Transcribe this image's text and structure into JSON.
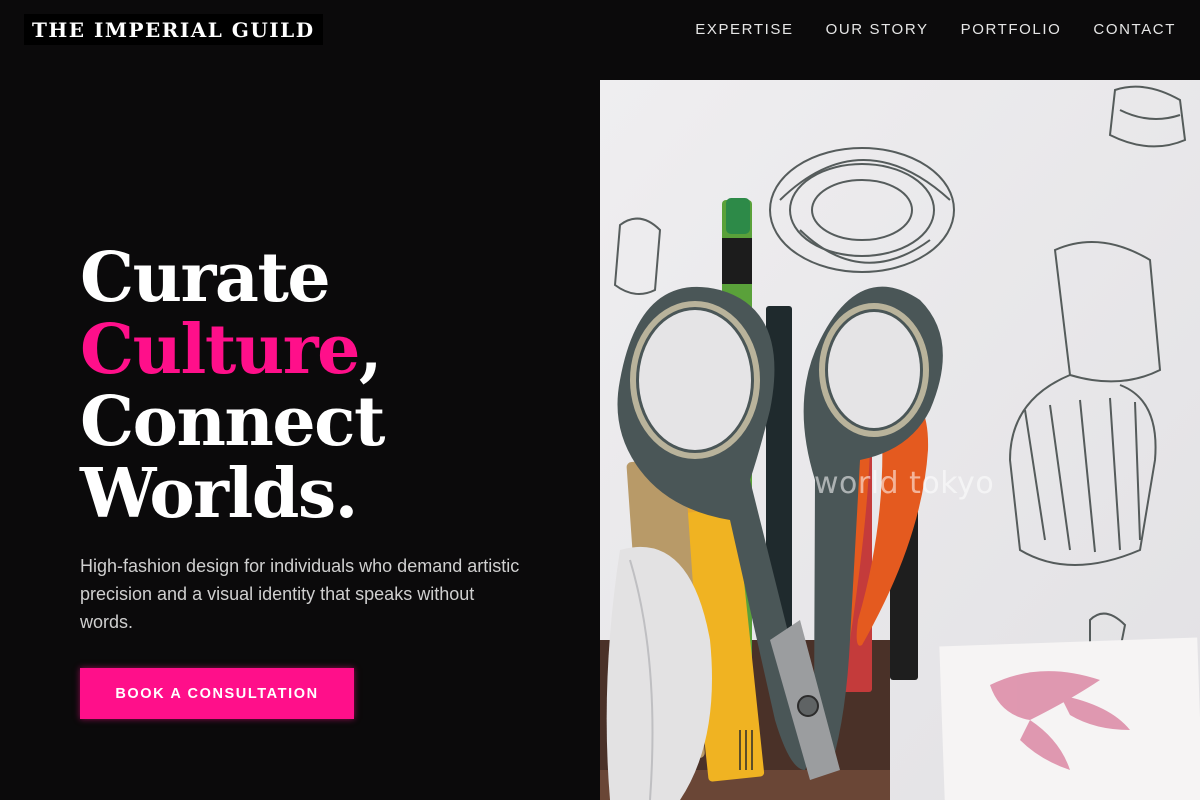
{
  "header": {
    "logo_text": "THE IMPERIAL GUILD",
    "nav": [
      {
        "label": "EXPERTISE"
      },
      {
        "label": "OUR STORY"
      },
      {
        "label": "PORTFOLIO"
      },
      {
        "label": "CONTACT"
      }
    ]
  },
  "hero": {
    "headline": {
      "line1": "Curate",
      "line2_accent": "Culture",
      "line2_rest": ",",
      "line3": "Connect",
      "line4": "Worlds."
    },
    "subtitle": "High-fashion design for individuals who demand artistic precision and a visual identity that speaks without words.",
    "cta_label": "BOOK A CONSULTATION"
  },
  "image": {
    "watermark": "world tokyo",
    "subject": "scissors-and-art-supplies-photo"
  },
  "colors": {
    "background": "#0b0a0b",
    "accent": "#ff0f8a",
    "text": "#ffffff",
    "muted": "#cfcfcf"
  }
}
